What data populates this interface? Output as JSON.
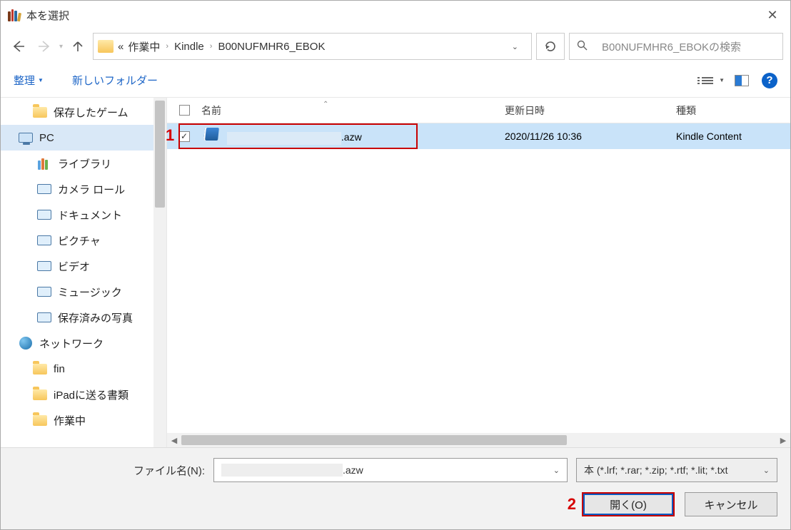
{
  "title": "本を選択",
  "breadcrumb": {
    "prefix": "«",
    "seg1": "作業中",
    "seg2": "Kindle",
    "seg3": "B00NUFMHR6_EBOK"
  },
  "search": {
    "placeholder": "B00NUFMHR6_EBOKの検索"
  },
  "toolbar": {
    "organize": "整理",
    "new_folder": "新しいフォルダー"
  },
  "sidebar": {
    "items": [
      {
        "label": "保存したゲーム",
        "icon": "folder"
      },
      {
        "label": "PC",
        "icon": "pc",
        "selected": true
      },
      {
        "label": "ライブラリ",
        "icon": "library"
      },
      {
        "label": "カメラ ロール",
        "icon": "monitor"
      },
      {
        "label": "ドキュメント",
        "icon": "monitor"
      },
      {
        "label": "ピクチャ",
        "icon": "monitor"
      },
      {
        "label": "ビデオ",
        "icon": "monitor"
      },
      {
        "label": "ミュージック",
        "icon": "monitor"
      },
      {
        "label": "保存済みの写真",
        "icon": "monitor"
      },
      {
        "label": "ネットワーク",
        "icon": "network"
      },
      {
        "label": "fin",
        "icon": "folder"
      },
      {
        "label": "iPadに送る書類",
        "icon": "folder"
      },
      {
        "label": "作業中",
        "icon": "folder"
      }
    ]
  },
  "columns": {
    "name": "名前",
    "date": "更新日時",
    "type": "種類"
  },
  "file": {
    "ext": ".azw",
    "date": "2020/11/26 10:36",
    "type": "Kindle Content"
  },
  "callouts": {
    "one": "1",
    "two": "2"
  },
  "footer": {
    "filename_label": "ファイル名(N):",
    "filename_ext": ".azw",
    "filter": "本 (*.lrf; *.rar; *.zip; *.rtf; *.lit; *.txt",
    "open": "開く(O)",
    "cancel": "キャンセル"
  }
}
